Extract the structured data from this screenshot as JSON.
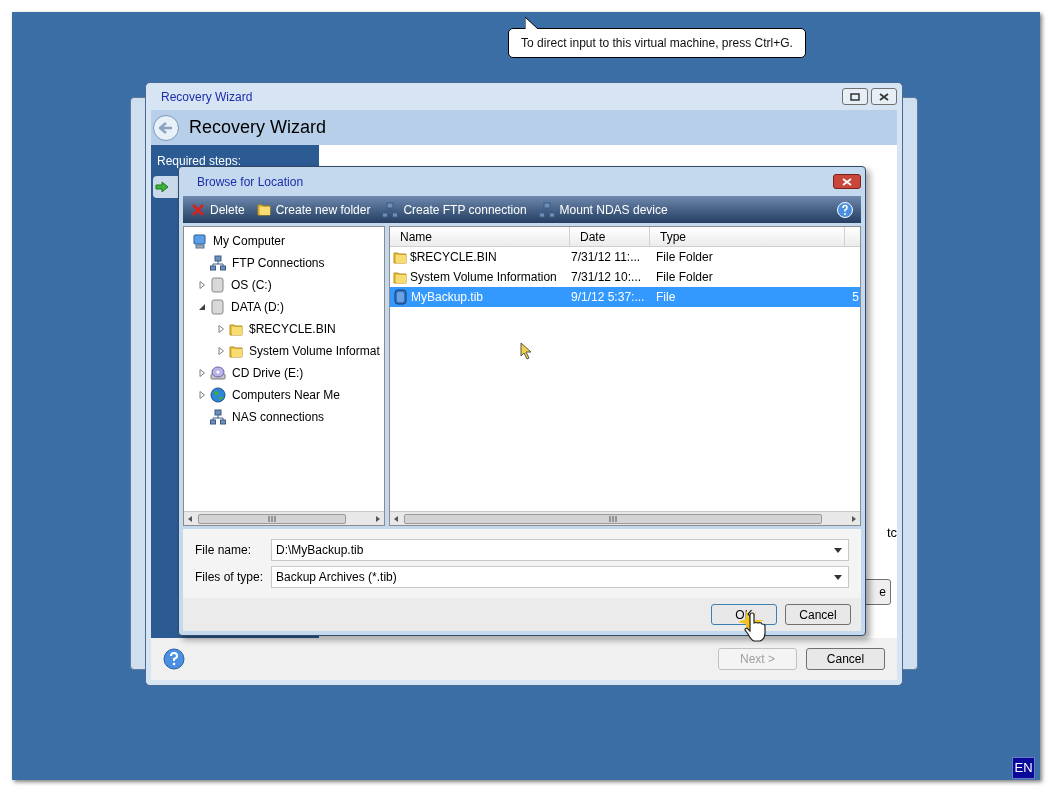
{
  "tooltip": {
    "text": "To direct input to this virtual machine, press Ctrl+G."
  },
  "wizard": {
    "title": "Recovery Wizard",
    "header": "Recovery Wizard",
    "sidebar_heading": "Required steps:",
    "steps": [
      {
        "selected": true
      }
    ],
    "side_text": "tc",
    "side_button": "e",
    "buttons": [
      {
        "label": "Next >",
        "disabled": true
      },
      {
        "label": "Cancel",
        "disabled": false
      }
    ]
  },
  "dialog": {
    "title": "Browse for Location",
    "toolbar": [
      {
        "label": "Delete",
        "kind": "delete"
      },
      {
        "label": "Create new folder",
        "kind": "folder"
      },
      {
        "label": "Create FTP connection",
        "kind": "network"
      },
      {
        "label": "Mount NDAS device",
        "kind": "network"
      }
    ],
    "tree": [
      {
        "label": "My Computer",
        "kind": "computer",
        "children": [
          {
            "label": "FTP Connections",
            "kind": "network"
          },
          {
            "label": "OS (C:)",
            "kind": "disk",
            "expanded": false
          },
          {
            "label": "DATA (D:)",
            "kind": "disk",
            "expanded": true,
            "children": [
              {
                "label": "$RECYCLE.BIN",
                "kind": "folder",
                "expanded": false
              },
              {
                "label": "System Volume Informat",
                "kind": "folder",
                "expanded": false
              }
            ]
          },
          {
            "label": "CD Drive (E:)",
            "kind": "cd",
            "expanded": false
          },
          {
            "label": "Computers Near Me",
            "kind": "globe",
            "expanded": false
          },
          {
            "label": "NAS connections",
            "kind": "network"
          }
        ]
      }
    ],
    "columns": [
      "Name",
      "Date",
      "Type"
    ],
    "rows": [
      {
        "name": "$RECYCLE.BIN",
        "date": "7/31/12 11:...",
        "type": "File Folder",
        "kind": "folder",
        "selected": false
      },
      {
        "name": "System Volume Information",
        "date": "7/31/12 10:...",
        "type": "File Folder",
        "kind": "folder",
        "selected": false
      },
      {
        "name": "MyBackup.tib",
        "date": "9/1/12 5:37:...",
        "type": "File",
        "column_4": "5",
        "kind": "file",
        "selected": true
      }
    ],
    "file_name_label": "File name:",
    "file_name": "D:\\MyBackup.tib",
    "file_type_label": "Files of type:",
    "file_type": "Backup Archives (*.tib)",
    "buttons": [
      {
        "label": "OK",
        "default": true
      },
      {
        "label": "Cancel",
        "default": false
      }
    ]
  },
  "language": "EN"
}
